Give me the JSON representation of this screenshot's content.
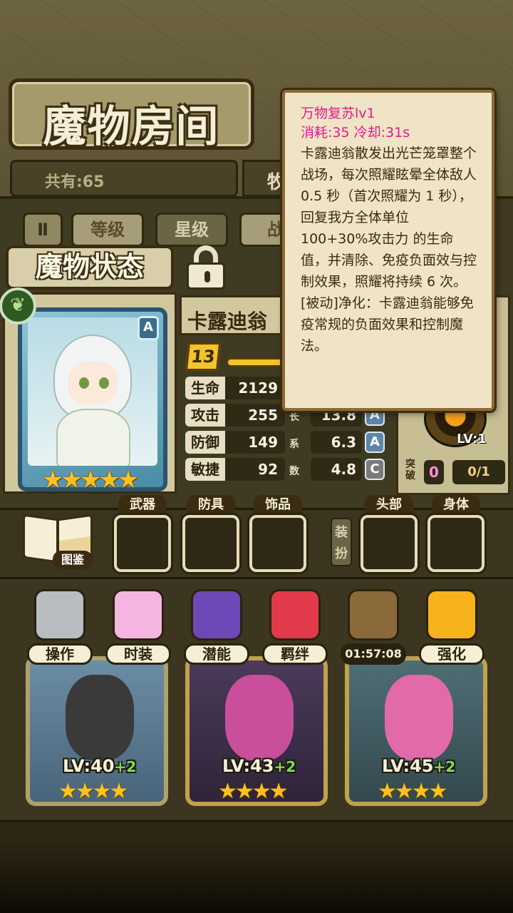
{
  "screen": {
    "title": "魔物房间",
    "count_label": "共有:65",
    "sort_label": "牧"
  },
  "filters": [
    {
      "label": "Ⅱ"
    },
    {
      "label": "等级"
    },
    {
      "label": "星级"
    },
    {
      "label": "战"
    }
  ],
  "status": {
    "title": "魔物状态",
    "lock_icon": "lock-icon"
  },
  "monster": {
    "name": "卡露迪翁",
    "rank": "A",
    "stars": "★★★★★",
    "level": "13",
    "element_icon": "leaf-icon",
    "stats": [
      {
        "label": "生命",
        "value": "2129"
      },
      {
        "label": "攻击",
        "value": "255",
        "growth_label": "长",
        "growth": "13.8",
        "grade": "A"
      },
      {
        "label": "防御",
        "value": "149",
        "growth_label": "系",
        "growth": "6.3",
        "grade": "A"
      },
      {
        "label": "敏捷",
        "value": "92",
        "growth_label": "数",
        "growth": "4.8",
        "grade": "C"
      }
    ]
  },
  "breakthrough": {
    "label": "突破",
    "count": "0",
    "ratio": "0/1",
    "orb_level": "LV:1"
  },
  "equipment": {
    "guide_label": "图鉴",
    "slots": [
      {
        "label": "武器"
      },
      {
        "label": "防具"
      },
      {
        "label": "饰品"
      },
      {
        "label": "头部"
      },
      {
        "label": "身体"
      }
    ],
    "dress_label": "装扮"
  },
  "menu": [
    {
      "label": "操作",
      "icon": "gear-icon",
      "color": "#b9bdc2"
    },
    {
      "label": "时装",
      "icon": "clothes-icon",
      "color": "#f4b6e0"
    },
    {
      "label": "潜能",
      "icon": "demon-icon",
      "color": "#6b49b6"
    },
    {
      "label": "羁绊",
      "icon": "heart-icon",
      "color": "#e23a4a"
    },
    {
      "label": "01:57:08",
      "icon": "gift-refresh-icon",
      "color": "#8a6a3a"
    },
    {
      "label": "强化",
      "icon": "arrow-up-icon",
      "color": "#f6b21a"
    }
  ],
  "cards": [
    {
      "level": "LV:40",
      "plus": "+2",
      "stars": "★★★★",
      "color": "#3a3a3a"
    },
    {
      "level": "LV:43",
      "plus": "+2",
      "stars": "★★★★",
      "color": "#c94f9c"
    },
    {
      "level": "LV:45",
      "plus": "+2",
      "stars": "★★★★",
      "color": "#e26aa8"
    }
  ],
  "tooltip": {
    "title": "万物复苏lv1",
    "cost": "消耗:35   冷却:31s",
    "description": "卡露迪翁散发出光芒笼罩整个战场，每次照耀眩晕全体敌人 0.5 秒（首次照耀为 1 秒），回复我方全体单位 100+30%攻击力 的生命值，并清除、免疫负面效与控制效果，照耀将持续 6 次。",
    "passive": "[被动]净化：卡露迪翁能够免疫常规的负面效果和控制魔法。"
  }
}
